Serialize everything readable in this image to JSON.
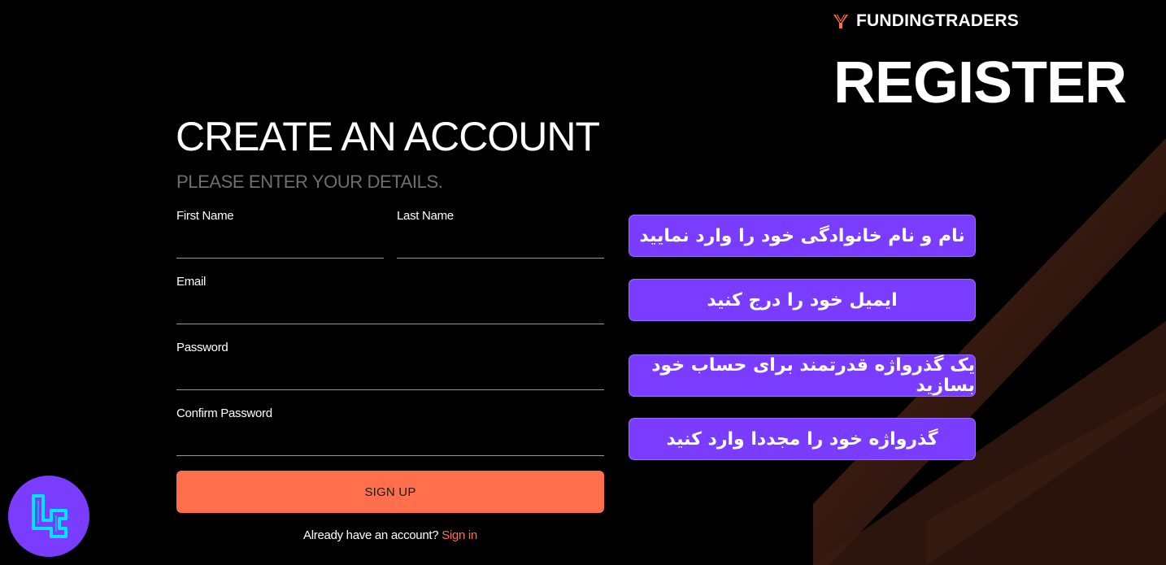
{
  "brand": {
    "name": "FUNDINGTRADERS",
    "accent": "#ff6f4b"
  },
  "banner": {
    "title": "REGISTER"
  },
  "form": {
    "title": "CREATE AN ACCOUNT",
    "subtitle": "PLEASE ENTER YOUR DETAILS.",
    "fields": {
      "first_name": {
        "label": "First Name",
        "value": "",
        "placeholder": ""
      },
      "last_name": {
        "label": "Last Name",
        "value": "",
        "placeholder": ""
      },
      "email": {
        "label": "Email",
        "value": "",
        "placeholder": ""
      },
      "password": {
        "label": "Password",
        "value": "",
        "placeholder": ""
      },
      "confirm_password": {
        "label": "Confirm Password",
        "value": "",
        "placeholder": ""
      }
    },
    "submit_label": "SIGN UP",
    "signin_prompt": "Already have an account?",
    "signin_link": "Sign in"
  },
  "annotations": [
    {
      "text": "نام و نام خانوادگی خود را وارد نمایید"
    },
    {
      "text": "ایمیل خود را درج کنید"
    },
    {
      "text": "یک گذرواژه قدرتمند برای حساب خود بسازید"
    },
    {
      "text": "گذرواژه خود را مجددا وارد کنید"
    }
  ],
  "colors": {
    "background": "#000000",
    "button": "#ff6f4b",
    "annotation": "#7a3cff",
    "subtitle": "#6f6f6f"
  },
  "icons": {
    "brand": "fundingtraders-logo-icon",
    "corner": "tradingfinder-logo-icon"
  }
}
